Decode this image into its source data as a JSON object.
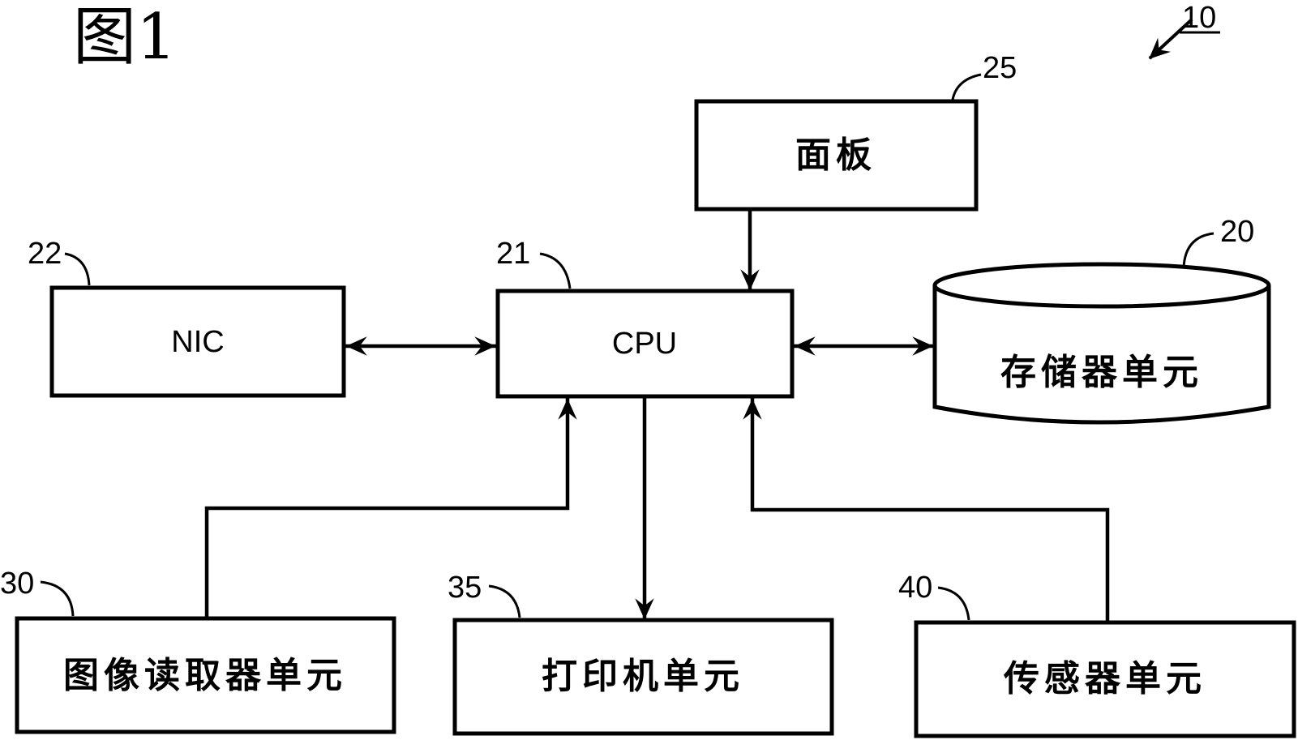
{
  "figure": {
    "title": "图1",
    "reference_number": "10"
  },
  "blocks": {
    "panel": {
      "ref": "25",
      "label": "面板"
    },
    "nic": {
      "ref": "22",
      "label": "NIC"
    },
    "cpu": {
      "ref": "21",
      "label": "CPU"
    },
    "storage": {
      "ref": "20",
      "label": "存储器单元"
    },
    "reader": {
      "ref": "30",
      "label": "图像读取器单元"
    },
    "printer": {
      "ref": "35",
      "label": "打印机单元"
    },
    "sensor": {
      "ref": "40",
      "label": "传感器单元"
    }
  },
  "connections": [
    {
      "from": "panel",
      "to": "cpu",
      "direction": "one-way"
    },
    {
      "from": "nic",
      "to": "cpu",
      "direction": "two-way"
    },
    {
      "from": "cpu",
      "to": "storage",
      "direction": "two-way"
    },
    {
      "from": "reader",
      "to": "cpu",
      "direction": "one-way"
    },
    {
      "from": "cpu",
      "to": "printer",
      "direction": "one-way"
    },
    {
      "from": "sensor",
      "to": "cpu",
      "direction": "one-way"
    }
  ]
}
